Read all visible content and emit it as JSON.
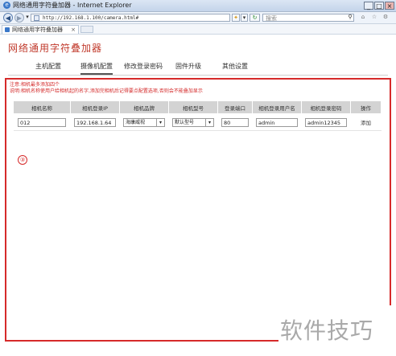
{
  "browser": {
    "window_title": "网络通用字符叠加器 - Internet Explorer",
    "address": "http://192.168.1.100/camera.html#",
    "search_placeholder": "搜索",
    "tab_title": "网络通用字符叠加器",
    "tab_close": "×"
  },
  "page": {
    "title": "网络通用字符叠加器",
    "menu": [
      "主机配置",
      "摄像机配置",
      "修改登录密码",
      "固件升级",
      "其他设置"
    ],
    "active_menu_index": 1,
    "note_line1": "注意:相机最多添加四个",
    "note_line2": "说明:相机名称使用户给相机起的名字,添加完相机后记得要点配置选项,否则会不能叠加显示",
    "table": {
      "headers": [
        "相机名称",
        "相机登录IP",
        "相机品牌",
        "相机型号",
        "登录端口",
        "相机登录用户名",
        "相机登录密码",
        "操作"
      ],
      "row": {
        "name": "012",
        "ip": "192.168.1.64",
        "brand": "海康威视",
        "model": "默认型号",
        "port": "80",
        "username": "admin",
        "password": "admin12345",
        "action": "添加"
      }
    },
    "step_marker": "③"
  },
  "watermark": "软件技巧",
  "colors": {
    "accent_red": "#d62a2a",
    "title_red": "#c0392b",
    "header_gray": "#d3d3d3"
  }
}
